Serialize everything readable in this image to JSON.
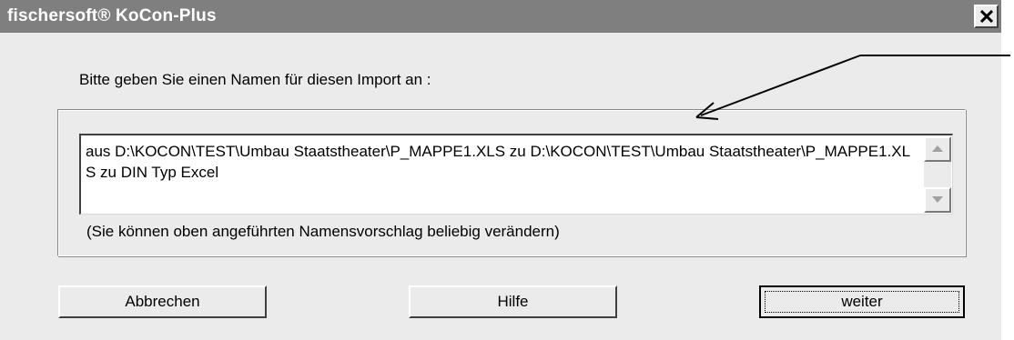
{
  "window": {
    "title": "fischersoft® KoCon-Plus",
    "close_glyph": "×"
  },
  "dialog": {
    "prompt": "Bitte geben Sie einen Namen für diesen Import an :",
    "name_value": "aus D:\\KOCON\\TEST\\Umbau Staatstheater\\P_MAPPE1.XLS zu D:\\KOCON\\TEST\\Umbau Staatstheater\\P_MAPPE1.XLS zu DIN Typ Excel",
    "hint": "(Sie können oben angeführten Namensvorschlag beliebig verändern)"
  },
  "buttons": {
    "cancel": "Abbrechen",
    "help": "Hilfe",
    "next": "weiter"
  },
  "icons": {
    "close": "close-icon",
    "scroll_up": "arrow-up-icon",
    "scroll_down": "arrow-down-icon",
    "annotation": "annotation-arrow"
  },
  "colors": {
    "titlebar": "#7f7f7f",
    "dialog_bg": "#ebebeb"
  }
}
